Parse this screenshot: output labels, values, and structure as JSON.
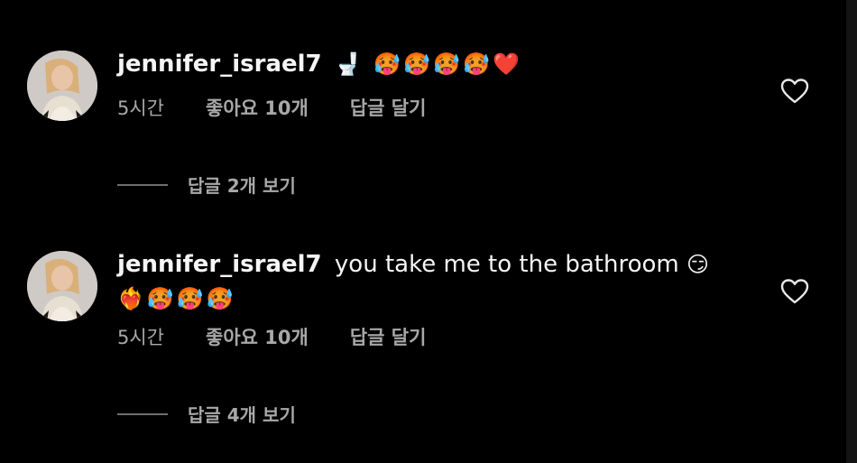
{
  "colors": {
    "background": "#000000",
    "primary_text": "#f5f5f5",
    "secondary_text": "#a8a8a8",
    "divider": "#6e6e6e"
  },
  "comments": [
    {
      "username": "jennifer_israel7",
      "text": "",
      "emoji": "🚽 🥵🥵🥵🥵❤️",
      "time": "5시간",
      "likes": "좋아요 10개",
      "reply": "답글 달기",
      "view_replies": "답글 2개 보기",
      "avatar_icon": "avatar-photo",
      "like_icon": "heart-outline-icon"
    },
    {
      "username": "jennifer_israel7",
      "text": "you take me to the bathroom",
      "emoji": "😏",
      "emoji_line2": "❤️‍🔥🥵🥵🥵",
      "time": "5시간",
      "likes": "좋아요 10개",
      "reply": "답글 달기",
      "view_replies": "답글 4개 보기",
      "avatar_icon": "avatar-photo",
      "like_icon": "heart-outline-icon"
    }
  ]
}
